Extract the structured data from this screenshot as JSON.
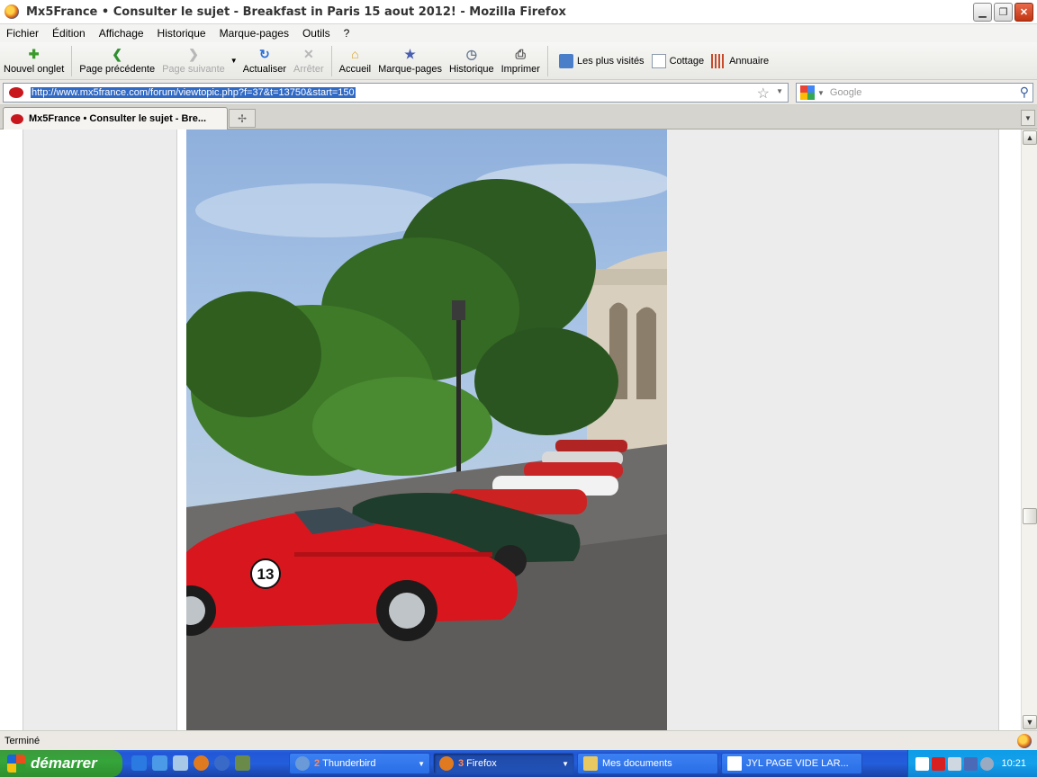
{
  "window": {
    "title": "Mx5France • Consulter le sujet - Breakfast in Paris 15 aout 2012! - Mozilla Firefox"
  },
  "menu": [
    "Fichier",
    "Édition",
    "Affichage",
    "Historique",
    "Marque-pages",
    "Outils",
    "?"
  ],
  "toolbar": {
    "new_tab": "Nouvel onglet",
    "back": "Page précédente",
    "forward": "Page suivante",
    "reload": "Actualiser",
    "stop": "Arrêter",
    "home": "Accueil",
    "bookmarks": "Marque-pages",
    "history": "Historique",
    "print": "Imprimer"
  },
  "bookmarks_bar": {
    "most_visited": "Les plus visités",
    "cottage": "Cottage",
    "annuaire": "Annuaire"
  },
  "address": {
    "url": "http://www.mx5france.com/forum/viewtopic.php?f=37&t=13750&start=150"
  },
  "search": {
    "placeholder": "Google"
  },
  "tabs": [
    {
      "label": "Mx5France • Consulter le sujet - Bre..."
    }
  ],
  "status": {
    "text": "Terminé"
  },
  "taskbar": {
    "start_label": "démarrer",
    "tasks": [
      {
        "count": "2",
        "label": "Thunderbird"
      },
      {
        "count": "3",
        "label": "Firefox"
      },
      {
        "count": "",
        "label": "Mes documents"
      },
      {
        "count": "",
        "label": "JYL   PAGE VIDE LAR..."
      }
    ],
    "clock": "10:21"
  },
  "photo": {
    "car_number": "13"
  }
}
